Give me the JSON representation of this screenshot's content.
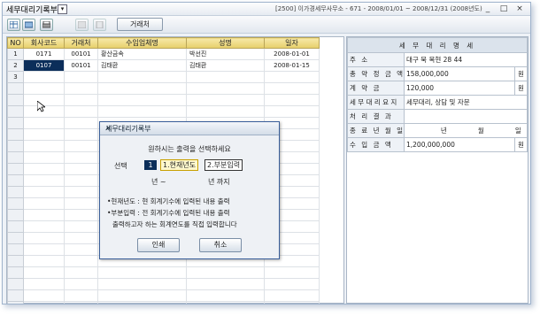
{
  "window": {
    "title": "세무대리기록부",
    "info": "[2500] 이가경세무사무소 - 671 - 2008/01/01 ~ 2008/12/31 (2008년도)",
    "controls": [
      "_",
      "□",
      "×"
    ]
  },
  "toolbar": {
    "icons": [
      "table-icon",
      "refresh-icon",
      "print-icon",
      "save-icon",
      "exit-icon"
    ],
    "button_label": "거래처"
  },
  "grid": {
    "headers": [
      "NO",
      "회사코드",
      "거래처",
      "수임업체명",
      "성명",
      "일자"
    ],
    "rows": [
      [
        "1",
        "0171",
        "00101",
        "황산금속",
        "박선진",
        "2008-01-01"
      ],
      [
        "2",
        "0107",
        "00101",
        "김태환",
        "김태환",
        "2008-01-15"
      ],
      [
        "3",
        "",
        "",
        "",
        "",
        ""
      ]
    ],
    "selected_cell": {
      "row": 1,
      "col": 1
    }
  },
  "ledger": {
    "title": "세 무 대 리 명 세",
    "address_label": "주          소",
    "address_value": "대구 북 복현 28 44",
    "total_fee_label": "총 약 정 금 액",
    "total_fee_value": "158,000,000",
    "contract_label": "계   약   금",
    "contract_value": "120,000",
    "request_label": "세 무 대 리 요 지",
    "request_value": "세무대리, 상담 및 자문",
    "result_label": "처 리 결 과",
    "result_value": "",
    "end_date_label": "종 료 년 월 일",
    "date_units": [
      "년",
      "월",
      "일"
    ],
    "revenue_label": "수 입 금 액",
    "revenue_value": "1,200,000,000",
    "won": "원"
  },
  "dialog": {
    "title": "세무대리기록부",
    "close": "×",
    "prompt": "원하시는 출력을 선택하세요",
    "select_label": "선택",
    "selected_value": "1",
    "option1": "1.현재년도",
    "option2": "2.부분입력",
    "year_from": "년 ~",
    "year_to": "년 까지",
    "note1": "•현재년도 : 현 회계기수에 입력된 내용 출력",
    "note2": "•부분입력 : 전 회계기수에 입력된 내용 출력",
    "note3": "출력하고자 하는 회계연도를 직접 입력합니다",
    "print_button": "인쇄",
    "cancel_button": "취소"
  }
}
